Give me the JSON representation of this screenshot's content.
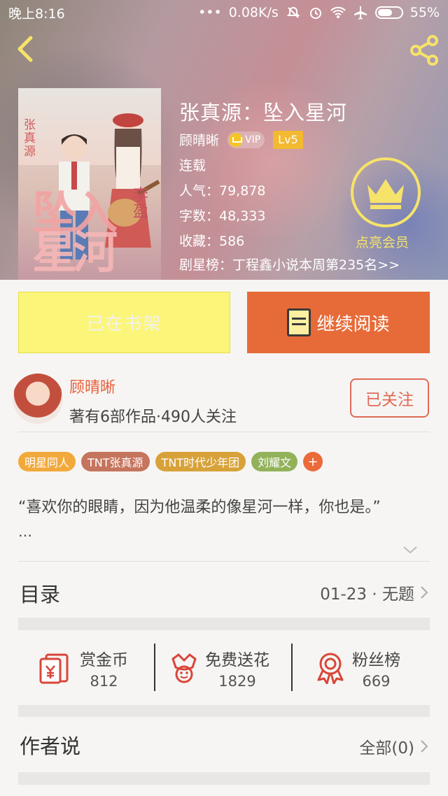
{
  "status_bar": {
    "time": "晚上8:16",
    "network_speed": "0.08K/s",
    "battery": "55%",
    "battery_level": 0.55
  },
  "book": {
    "title": "张真源：坠入星河",
    "author": "顾晴晰",
    "vip_label": "VIP",
    "level": "Lv5",
    "status": "连载",
    "popularity": "人气：79,878",
    "word_count": "字数：48,333",
    "favorites": "收藏：586",
    "rank": "剧星榜：丁程鑫小说本周第235名>>",
    "cover_text": {
      "title_line1": "坠入",
      "title_line2": "星河",
      "left_name": "张真源",
      "right_name": "李盈"
    }
  },
  "member": {
    "label": "点亮会员"
  },
  "actions": {
    "shelf_label": "已在书架",
    "read_label": "继续阅读"
  },
  "author_panel": {
    "name": "顾晴晰",
    "meta": "著有6部作品·490人关注",
    "follow_label": "已关注"
  },
  "tags": [
    {
      "label": "明星同人",
      "color": "#f2a93b"
    },
    {
      "label": "TNT张真源",
      "color": "#c5745d"
    },
    {
      "label": "TNT时代少年团",
      "color": "#d7a23a"
    },
    {
      "label": "刘耀文",
      "color": "#92b25a"
    }
  ],
  "tag_more": "+",
  "description": "“喜欢你的眼睛，因为他温柔的像星河一样，你也是。”",
  "description_more": "…",
  "toc": {
    "title": "目录",
    "latest": "01-23 · 无题"
  },
  "stats": [
    {
      "label": "赏金币",
      "value": "812",
      "icon": "reward-coin-icon"
    },
    {
      "label": "免费送花",
      "value": "1829",
      "icon": "flower-icon"
    },
    {
      "label": "粉丝榜",
      "value": "669",
      "icon": "medal-icon"
    }
  ],
  "author_says": {
    "title": "作者说",
    "all_label": "全部(0)"
  },
  "colors": {
    "accent_orange": "#e76b38",
    "shelf_yellow": "#fbf67a",
    "member_yellow": "#f6e36a",
    "author_red": "#e8603c"
  }
}
